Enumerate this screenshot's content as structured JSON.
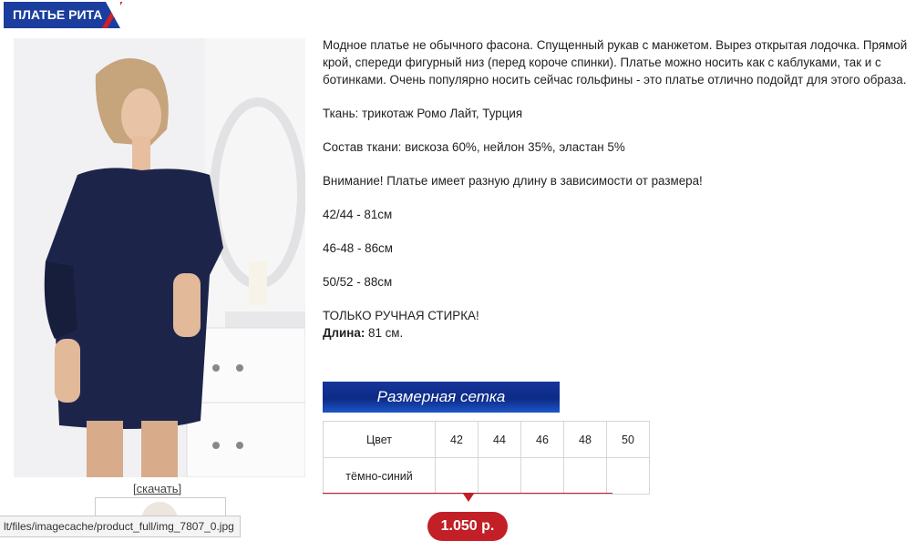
{
  "product": {
    "title": "ПЛАТЬЕ РИТА",
    "download_label": "[скачать]",
    "image_url_status": "lt/files/imagecache/product_full/img_7807_0.jpg",
    "description": [
      " Модное платье не обычного фасона. Спущенный рукав с манжетом. Вырез открытая лодочка. Прямой крой, спереди фигурный низ (перед короче спинки).  Платье можно носить как с каблуками, так и с ботинками. Очень популярно носить сейчас гольфины - это платье отлично подойдт для этого образа.",
      "Ткань: трикотаж Ромо Лайт, Турция",
      "Состав ткани: вискоза 60%, нейлон 35%, эластан 5%",
      "Внимание! Платье имеет разную длину в зависимости от размера!",
      "42/44 - 81см",
      "46-48 - 86см",
      "50/52 - 88см",
      "ТОЛЬКО РУЧНАЯ СТИРКА!"
    ],
    "length_label": "Длина:",
    "length_value": " 81 см.",
    "size_chart_button": "Размерная сетка",
    "size_table": {
      "header": [
        "Цвет",
        "42",
        "44",
        "46",
        "48",
        "50"
      ],
      "rows": [
        [
          "тёмно-синий",
          "",
          "",
          "",
          "",
          ""
        ]
      ]
    },
    "price": "1.050 р."
  },
  "colors": {
    "brand_blue": "#1a3d9e",
    "accent_red": "#c21f26",
    "dress": "#1c2549"
  }
}
